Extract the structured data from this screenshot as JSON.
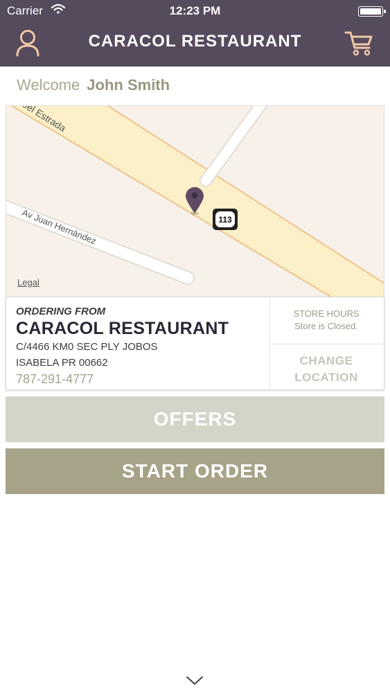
{
  "status_bar": {
    "carrier": "Carrier",
    "time": "12:23 PM",
    "icons": [
      "wifi-icon",
      "battery-icon"
    ]
  },
  "nav": {
    "title": "CARACOL RESTAURANT",
    "left_icon": "user-icon",
    "right_icon": "cart-icon",
    "background_color": "#564a5d"
  },
  "welcome": {
    "label": "Welcome",
    "name": "John Smith"
  },
  "map": {
    "streets": [
      "oel Estrada",
      "Av Juan Hernández"
    ],
    "route_badge": "113",
    "legal": "Legal",
    "pin_icon": "map-pin-icon"
  },
  "store": {
    "ordering_from": "ORDERING FROM",
    "name": "CARACOL RESTAURANT",
    "address_line1": "C/4466 KM0 SEC PLY JOBOS",
    "address_line2": "ISABELA PR 00662",
    "phone": "787-291-4777",
    "hours_title": "STORE HOURS",
    "hours_status": "Store is Closed.",
    "change_location_line1": "CHANGE",
    "change_location_line2": "LOCATION"
  },
  "buttons": {
    "offers": "OFFERS",
    "start_order": "START ORDER"
  },
  "colors": {
    "accent": "#a7a389",
    "accent_light": "#d5d4c9",
    "header": "#564a5d"
  }
}
